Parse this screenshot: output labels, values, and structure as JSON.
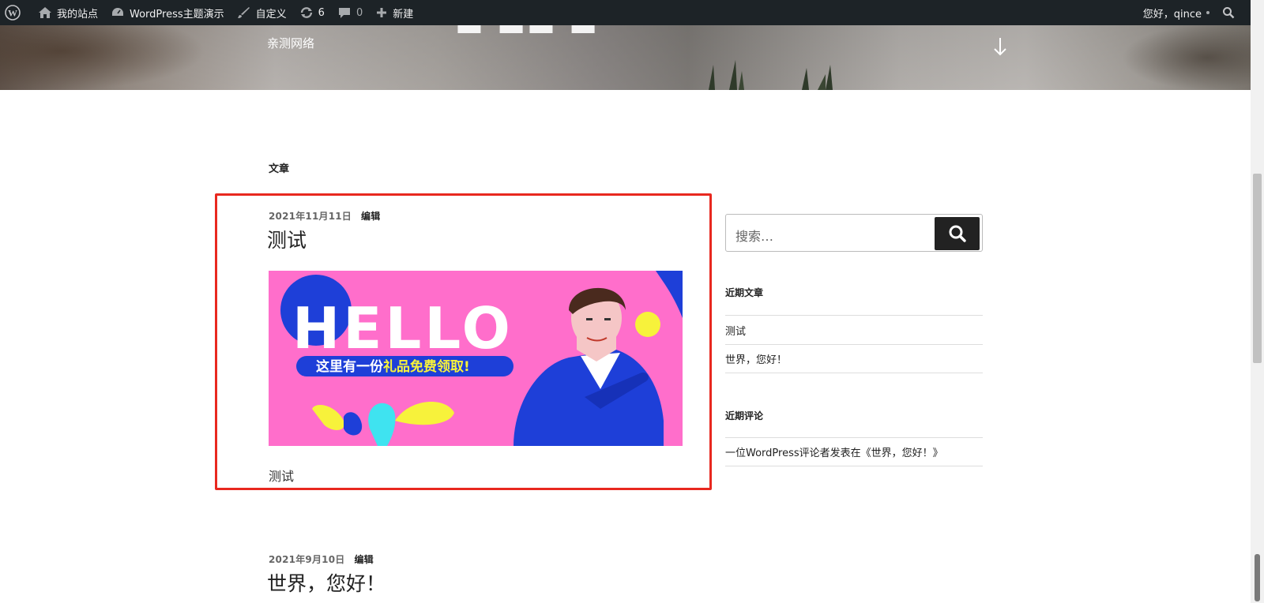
{
  "admin_bar": {
    "my_site": "我的站点",
    "theme_demo": "WordPress主题演示",
    "customize": "自定义",
    "updates_count": "6",
    "comments_count": "0",
    "new": "新建",
    "greeting": "您好，qince"
  },
  "header": {
    "site_description": "亲测网络"
  },
  "main": {
    "section_title": "文章",
    "posts": [
      {
        "date": "2021年11月11日",
        "edit": "编辑",
        "title": "测试",
        "excerpt": "测试",
        "image": {
          "headline": "HELLO",
          "banner_text_white": "这里有一份",
          "banner_text_yellow": "礼品免费领取!"
        }
      },
      {
        "date": "2021年9月10日",
        "edit": "编辑",
        "title": "世界，您好！"
      }
    ]
  },
  "sidebar": {
    "search_placeholder": "搜索…",
    "recent_posts_title": "近期文章",
    "recent_posts": [
      "测试",
      "世界，您好！"
    ],
    "recent_comments_title": "近期评论",
    "recent_comments": [
      "一位WordPress评论者发表在《世界，您好！》"
    ]
  },
  "colors": {
    "admin_bar_bg": "#1d2327",
    "highlight_border": "#e8281f",
    "image_pink": "#ff6ecb",
    "image_blue": "#1e3fd8",
    "image_yellow": "#f7f23b"
  }
}
